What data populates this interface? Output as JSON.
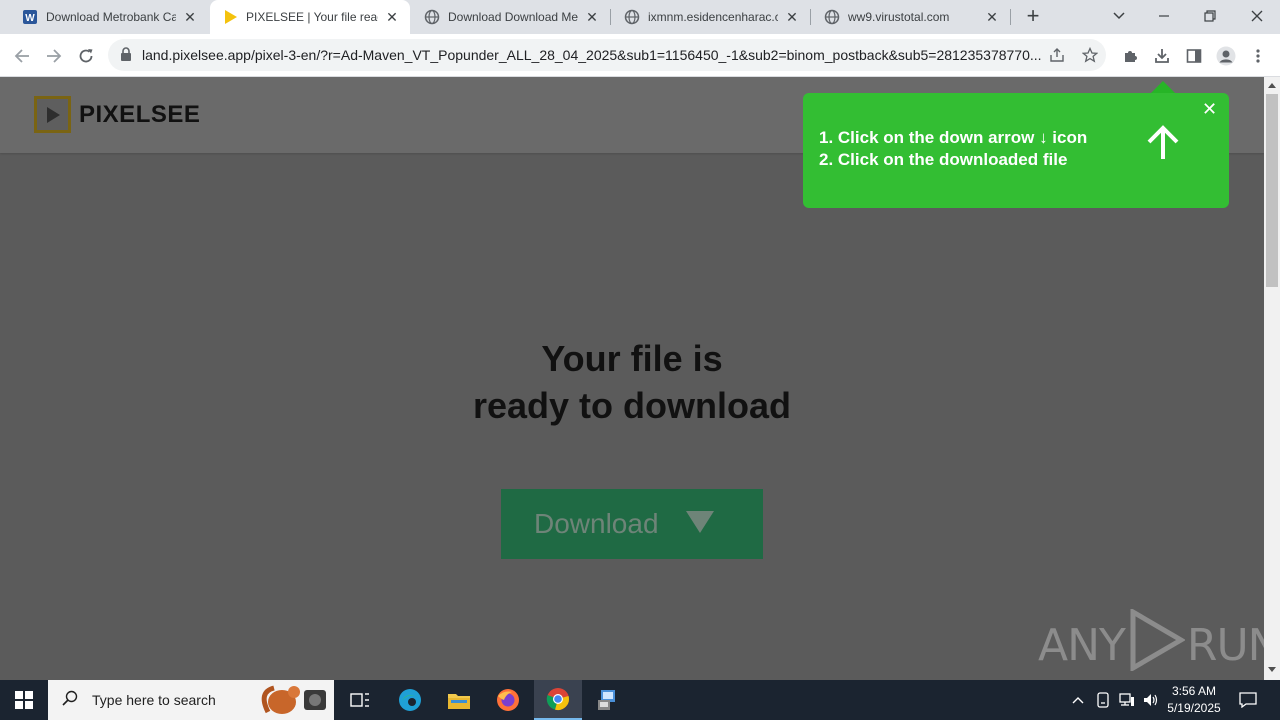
{
  "browser": {
    "tabs": [
      {
        "title": "Download Metrobank Ca",
        "favicon": "word-doc-icon",
        "active": false
      },
      {
        "title": "PIXELSEE | Your file ready",
        "favicon": "pixelsee-play-icon",
        "active": true
      },
      {
        "title": "Download Download Me",
        "favicon": "globe-icon",
        "active": false
      },
      {
        "title": "ixmnm.esidencenharac.c",
        "favicon": "globe-icon",
        "active": false
      },
      {
        "title": "ww9.virustotal.com",
        "favicon": "globe-icon",
        "active": false
      }
    ],
    "url": "land.pixelsee.app/pixel-3-en/?r=Ad-Maven_VT_Popunder_ALL_28_04_2025&sub1=1156450_-1&sub2=binom_postback&sub5=281235378770..."
  },
  "site": {
    "logo_text": "PIXELSEE",
    "headline_line1": "Your file is",
    "headline_line2": "ready to download",
    "download_label": "Download"
  },
  "popup": {
    "line1": "1. Click on the down arrow ↓ icon",
    "line2": "2. Click on the downloaded file",
    "close": "✕"
  },
  "watermark": {
    "text_left": "ANY",
    "text_right": "RUN"
  },
  "taskbar": {
    "search_placeholder": "Type here to search",
    "time": "3:56 AM",
    "date": "5/19/2025"
  },
  "colors": {
    "popup_green": "#33be33",
    "download_button": "#1f6a44",
    "logo_frame": "#7a6413"
  }
}
